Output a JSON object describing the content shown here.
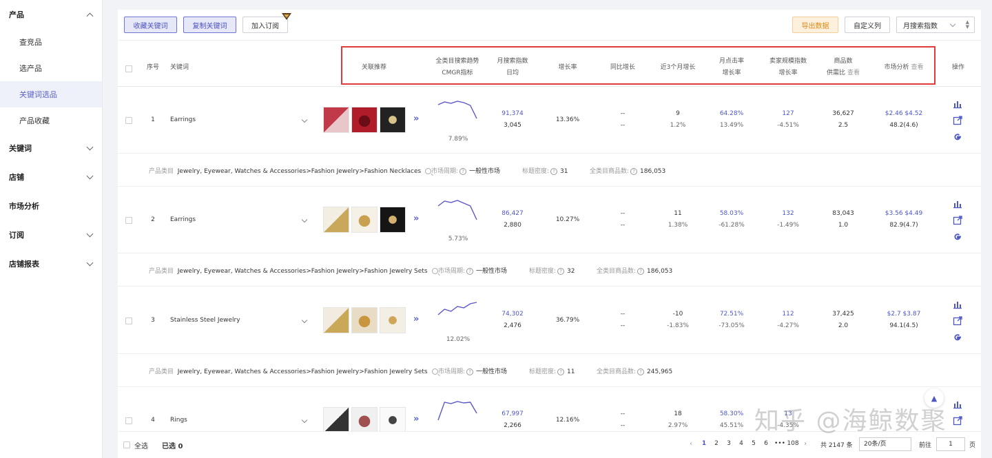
{
  "sidebar": {
    "groups": [
      {
        "label": "产品",
        "expanded": true,
        "items": [
          "查竞品",
          "选产品",
          "关键词选品",
          "产品收藏"
        ]
      },
      {
        "label": "关键词"
      },
      {
        "label": "店铺"
      },
      {
        "label": "市场分析"
      },
      {
        "label": "订阅"
      },
      {
        "label": "店铺报表"
      }
    ],
    "active_item": "关键词选品"
  },
  "toolbar": {
    "collect_label": "收藏关键词",
    "copy_label": "复制关键词",
    "subscribe_label": "加入订阅",
    "export_label": "导出数据",
    "custom_cols_label": "自定义列",
    "sort_select": "月搜索指数"
  },
  "columns": {
    "index": "序号",
    "keyword": "关键词",
    "related": "关联推荐",
    "trend_1": "全类目搜索趋势",
    "trend_2": "CMGR指标",
    "monthly_1": "月搜索指数",
    "monthly_2": "日均",
    "growth": "增长率",
    "yoy": "同比增长",
    "three_month": "近3个月增长",
    "ctr_1": "月点击率",
    "ctr_2": "增长率",
    "seller_1": "卖家规模指数",
    "seller_2": "增长率",
    "products_1": "商品数",
    "products_2": "供需比",
    "products_view": "查看",
    "market": "市场分析",
    "market_view": "查看",
    "ops": "操作"
  },
  "rows": [
    {
      "index": "1",
      "keyword": "Earrings",
      "cmgr": "7.89%",
      "monthly": "91,374",
      "daily": "3,045",
      "growth": "13.36%",
      "yoy_a": "--",
      "yoy_b": "--",
      "three_a": "9",
      "three_b": "1.2%",
      "ctr_a": "64.28%",
      "ctr_b": "13.49%",
      "seller_a": "127",
      "seller_b": "-4.51%",
      "prod_a": "36,627",
      "prod_b": "2.5",
      "market_a": "$2.46 $4.52",
      "market_b": "48.2(4.6)",
      "trend": [
        8,
        4,
        6,
        3,
        5,
        9,
        28
      ],
      "info": {
        "category_label": "产品类目",
        "category": "Jewelry, Eyewear, Watches & Accessories>Fashion Jewelry>Fashion Necklaces",
        "cycle_label": "市场周期:",
        "cycle": "一般性市场",
        "density_label": "标题密度:",
        "density": "31",
        "total_label": "全类目商品数:",
        "total": "186,053"
      }
    },
    {
      "index": "2",
      "keyword": "Earrings",
      "cmgr": "5.73%",
      "monthly": "86,427",
      "daily": "2,880",
      "growth": "10.27%",
      "yoy_a": "--",
      "yoy_b": "--",
      "three_a": "11",
      "three_b": "1.38%",
      "ctr_a": "58.03%",
      "ctr_b": "-61.28%",
      "seller_a": "132",
      "seller_b": "-1.49%",
      "prod_a": "83,043",
      "prod_b": "1.0",
      "market_a": "$3.56 $4.49",
      "market_b": "82.9(4.7)",
      "trend": [
        10,
        3,
        5,
        2,
        6,
        10,
        30
      ],
      "info": {
        "category_label": "产品类目",
        "category": "Jewelry, Eyewear, Watches & Accessories>Fashion Jewelry>Fashion Jewelry Sets",
        "cycle_label": "市场周期:",
        "cycle": "一般性市场",
        "density_label": "标题密度:",
        "density": "32",
        "total_label": "全类目商品数:",
        "total": "186,053"
      }
    },
    {
      "index": "3",
      "keyword": "Stainless Steel Jewelry",
      "cmgr": "12.02%",
      "monthly": "74,302",
      "daily": "2,476",
      "growth": "36.79%",
      "yoy_a": "--",
      "yoy_b": "--",
      "three_a": "-10",
      "three_b": "-1.83%",
      "ctr_a": "72.51%",
      "ctr_b": "-73.05%",
      "seller_a": "112",
      "seller_b": "-4.27%",
      "prod_a": "37,425",
      "prod_b": "2.0",
      "market_a": "$2.7 $3.87",
      "market_b": "94.1(4.5)",
      "trend": [
        22,
        14,
        17,
        10,
        12,
        6,
        4
      ],
      "info": {
        "category_label": "产品类目",
        "category": "Jewelry, Eyewear, Watches & Accessories>Fashion Jewelry>Fashion Jewelry Sets",
        "cycle_label": "市场周期:",
        "cycle": "一般性市场",
        "density_label": "标题密度:",
        "density": "11",
        "total_label": "全类目商品数:",
        "total": "245,965"
      }
    },
    {
      "index": "4",
      "keyword": "Rings",
      "cmgr": "",
      "monthly": "67,997",
      "daily": "2,266",
      "growth": "12.16%",
      "yoy_a": "--",
      "yoy_b": "--",
      "three_a": "18",
      "three_b": "2.97%",
      "ctr_a": "58.30%",
      "ctr_b": "45.51%",
      "seller_a": "13",
      "seller_b": "-4.35%",
      "prod_a": "",
      "prod_b": "",
      "market_a": "",
      "market_b": "",
      "trend": [
        30,
        4,
        6,
        3,
        5,
        4,
        20
      ],
      "info": null
    }
  ],
  "footer": {
    "select_all": "全选",
    "selected": "已选 0",
    "pages": [
      "1",
      "2",
      "3",
      "4",
      "5",
      "6",
      "108"
    ],
    "ellipsis": "•••",
    "total": "共 2147 条",
    "per_page": "20条/页",
    "goto_label": "前往",
    "goto_value": "1",
    "page_suffix": "页"
  },
  "watermark": "知乎 @海鲸数聚",
  "colors": {
    "accent": "#4c56c6",
    "highlight": "#e03a3a",
    "export": "#e08a16"
  }
}
